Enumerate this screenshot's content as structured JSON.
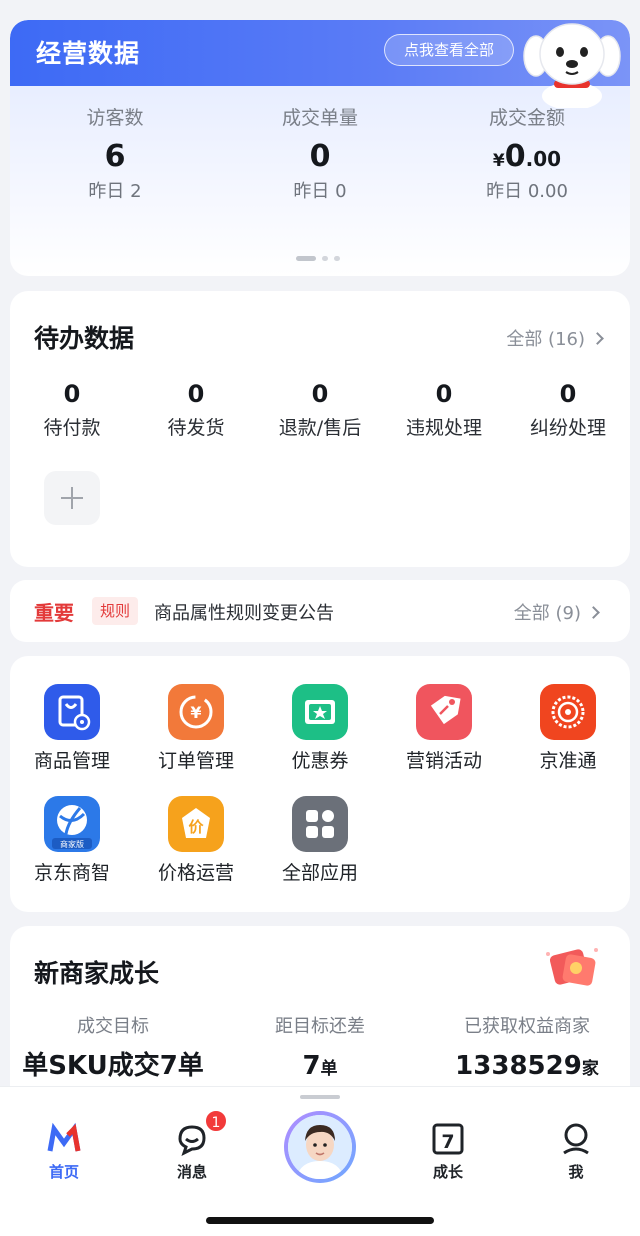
{
  "business": {
    "title": "经营数据",
    "view_all": "点我查看全部",
    "stats": [
      {
        "label": "访客数",
        "value": "6",
        "yesterday": "昨日 2"
      },
      {
        "label": "成交单量",
        "value": "0",
        "yesterday": "昨日 0"
      },
      {
        "label": "成交金额",
        "currency": "¥",
        "value_int": "0",
        "value_dec": ".00",
        "yesterday": "昨日 0.00"
      }
    ]
  },
  "todo": {
    "title": "待办数据",
    "more": "全部 (16)",
    "items": [
      {
        "count": "0",
        "label": "待付款"
      },
      {
        "count": "0",
        "label": "待发货"
      },
      {
        "count": "0",
        "label": "退款/售后"
      },
      {
        "count": "0",
        "label": "违规处理"
      },
      {
        "count": "0",
        "label": "纠纷处理"
      }
    ]
  },
  "notice": {
    "important": "重要",
    "tag": "规则",
    "text": "商品属性规则变更公告",
    "more": "全部 (9)"
  },
  "apps": [
    {
      "label": "商品管理",
      "icon": "product-management-icon",
      "color": "#2f5bea"
    },
    {
      "label": "订单管理",
      "icon": "order-management-icon",
      "color": "#f2793a"
    },
    {
      "label": "优惠券",
      "icon": "coupon-icon",
      "color": "#1dbf86"
    },
    {
      "label": "营销活动",
      "icon": "marketing-tag-icon",
      "color": "#f0555e"
    },
    {
      "label": "京准通",
      "icon": "jingzhuntong-icon",
      "color": "#f0451f"
    },
    {
      "label": "京东商智",
      "icon": "jd-shangzhi-icon",
      "color": "#2c79e8",
      "badge": "商家版"
    },
    {
      "label": "价格运营",
      "icon": "price-operation-icon",
      "color": "#f6a21c",
      "glyph": "价"
    },
    {
      "label": "全部应用",
      "icon": "all-apps-icon",
      "color": "#6b7079"
    }
  ],
  "growth": {
    "title": "新商家成长",
    "columns": [
      {
        "label": "成交目标",
        "value": "单SKU成交7单",
        "unit": ""
      },
      {
        "label": "距目标还差",
        "value": "7",
        "unit": "单"
      },
      {
        "label": "已获取权益商家",
        "value": "1338529",
        "unit": "家"
      }
    ]
  },
  "tabs": [
    {
      "label": "首页",
      "icon": "home-logo-icon",
      "active": true
    },
    {
      "label": "消息",
      "icon": "message-icon",
      "badge": "1"
    },
    {
      "label": "",
      "icon": "avatar-icon"
    },
    {
      "label": "成长",
      "icon": "growth-calendar-icon",
      "glyph": "7"
    },
    {
      "label": "我",
      "icon": "profile-icon"
    }
  ],
  "colors": {
    "accent": "#3d6af5",
    "danger": "#e33a3a",
    "background": "#f2f3f7"
  }
}
